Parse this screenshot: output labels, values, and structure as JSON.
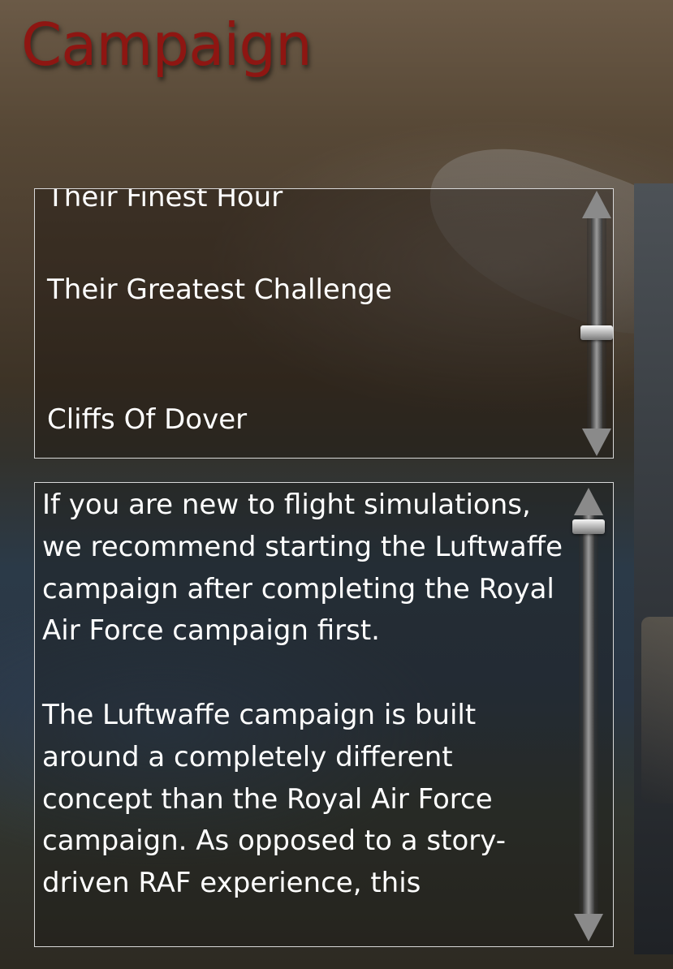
{
  "header": {
    "title": "Campaign"
  },
  "campaign_list": {
    "items": [
      {
        "label": "Their Finest Hour"
      },
      {
        "label": "Their Greatest Challenge"
      },
      {
        "label": "Cliffs Of Dover"
      }
    ]
  },
  "description": {
    "text": "If you are new to flight simulations, we recommend starting the Luftwaffe campaign after completing the Royal Air Force campaign first.\n\nThe Luftwaffe campaign is built around a completely different concept than the Royal Air Force campaign. As opposed to a story-driven RAF experience, this"
  },
  "scroll_state": {
    "list_position": 0.55,
    "description_position": 0.0
  },
  "colors": {
    "title": "#8e1612",
    "text": "#ffffff",
    "panel_border": "#d8d8d8"
  },
  "icons": {
    "scroll_up": "triangle-up",
    "scroll_down": "triangle-down"
  }
}
